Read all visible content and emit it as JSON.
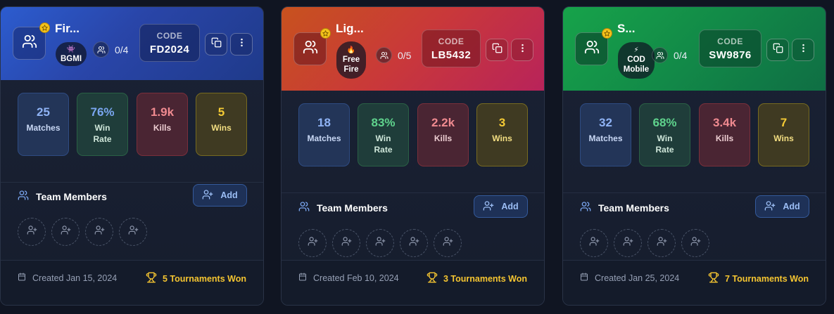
{
  "cards": [
    {
      "team_name": "Fir...",
      "game": {
        "emoji": "👾",
        "name": "BGMI"
      },
      "members_count": "0/4",
      "code_label": "CODE",
      "code": "FD2024",
      "stats": [
        {
          "value": "25",
          "label": "Matches"
        },
        {
          "value": "76%",
          "label": "Win Rate"
        },
        {
          "value": "1.9k",
          "label": "Kills"
        },
        {
          "value": "5",
          "label": "Wins"
        }
      ],
      "members_title": "Team Members",
      "add_label": "Add",
      "empty_slots": 4,
      "created": "Created Jan 15, 2024",
      "tournaments_won": "5 Tournaments Won"
    },
    {
      "team_name": "Lig...",
      "game": {
        "emoji": "🔥",
        "name": "Free Fire"
      },
      "members_count": "0/5",
      "code_label": "CODE",
      "code": "LB5432",
      "stats": [
        {
          "value": "18",
          "label": "Matches"
        },
        {
          "value": "83%",
          "label": "Win Rate"
        },
        {
          "value": "2.2k",
          "label": "Kills"
        },
        {
          "value": "3",
          "label": "Wins"
        }
      ],
      "members_title": "Team Members",
      "add_label": "Add",
      "empty_slots": 5,
      "created": "Created Feb 10, 2024",
      "tournaments_won": "3 Tournaments Won"
    },
    {
      "team_name": "S...",
      "game": {
        "emoji": "⚡",
        "name": "COD Mobile"
      },
      "members_count": "0/4",
      "code_label": "CODE",
      "code": "SW9876",
      "stats": [
        {
          "value": "32",
          "label": "Matches"
        },
        {
          "value": "68%",
          "label": "Win Rate"
        },
        {
          "value": "3.4k",
          "label": "Kills"
        },
        {
          "value": "7",
          "label": "Wins"
        }
      ],
      "members_title": "Team Members",
      "add_label": "Add",
      "empty_slots": 4,
      "created": "Created Jan 25, 2024",
      "tournaments_won": "7 Tournaments Won"
    }
  ],
  "colors": {
    "card1_header": "#2945a8",
    "card2_header": "#c9383a",
    "card3_header": "#128a48",
    "gold": "#f5c531"
  }
}
